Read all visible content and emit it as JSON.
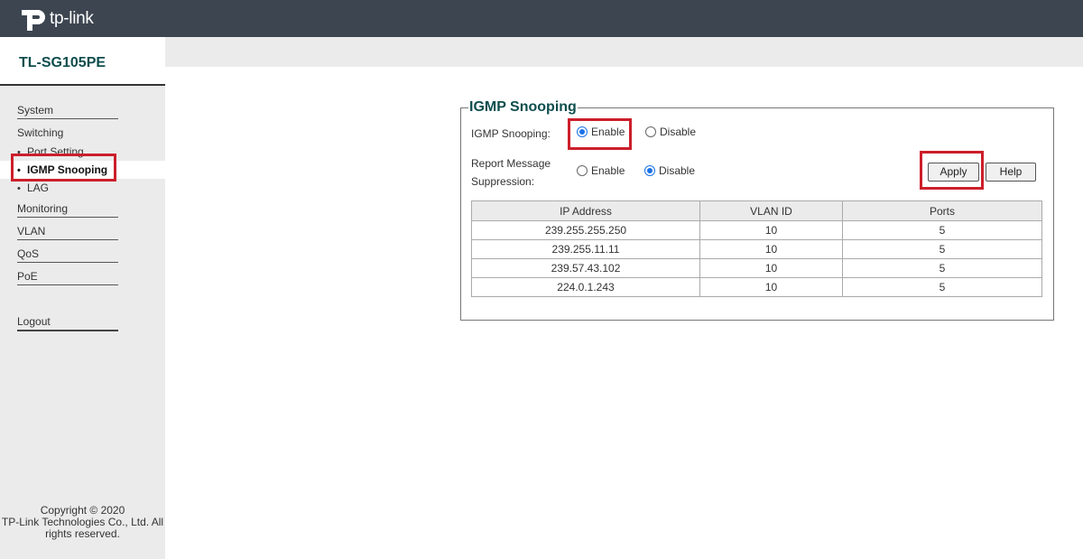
{
  "header": {
    "brand": "tp-link",
    "model": "TL-SG105PE"
  },
  "sidebar": {
    "items": [
      {
        "label": "System"
      },
      {
        "label": "Switching"
      },
      {
        "label": "Port Setting"
      },
      {
        "label": "IGMP Snooping"
      },
      {
        "label": "LAG"
      },
      {
        "label": "Monitoring"
      },
      {
        "label": "VLAN"
      },
      {
        "label": "QoS"
      },
      {
        "label": "PoE"
      },
      {
        "label": "Logout"
      }
    ],
    "bullet": "•",
    "copyright": [
      "Copyright © 2020",
      "TP-Link Technologies Co., Ltd. All",
      "rights reserved."
    ]
  },
  "panel": {
    "title": "IGMP Snooping",
    "igmp_label": "IGMP Snooping:",
    "report_label_1": "Report Message",
    "report_label_2": "Suppression:",
    "enable": "Enable",
    "disable": "Disable",
    "igmp_state": "Enable",
    "report_state": "Disable",
    "apply": "Apply",
    "help": "Help"
  },
  "table": {
    "headers": [
      "IP Address",
      "VLAN ID",
      "Ports"
    ],
    "rows": [
      [
        "239.255.255.250",
        "10",
        "5"
      ],
      [
        "239.255.11.11",
        "10",
        "5"
      ],
      [
        "239.57.43.102",
        "10",
        "5"
      ],
      [
        "224.0.1.243",
        "10",
        "5"
      ]
    ]
  },
  "colors": {
    "topbar": "#3c4550",
    "accent": "#0e4d4d",
    "highlight": "#cc1f2b",
    "radio": "#1a73e8"
  }
}
